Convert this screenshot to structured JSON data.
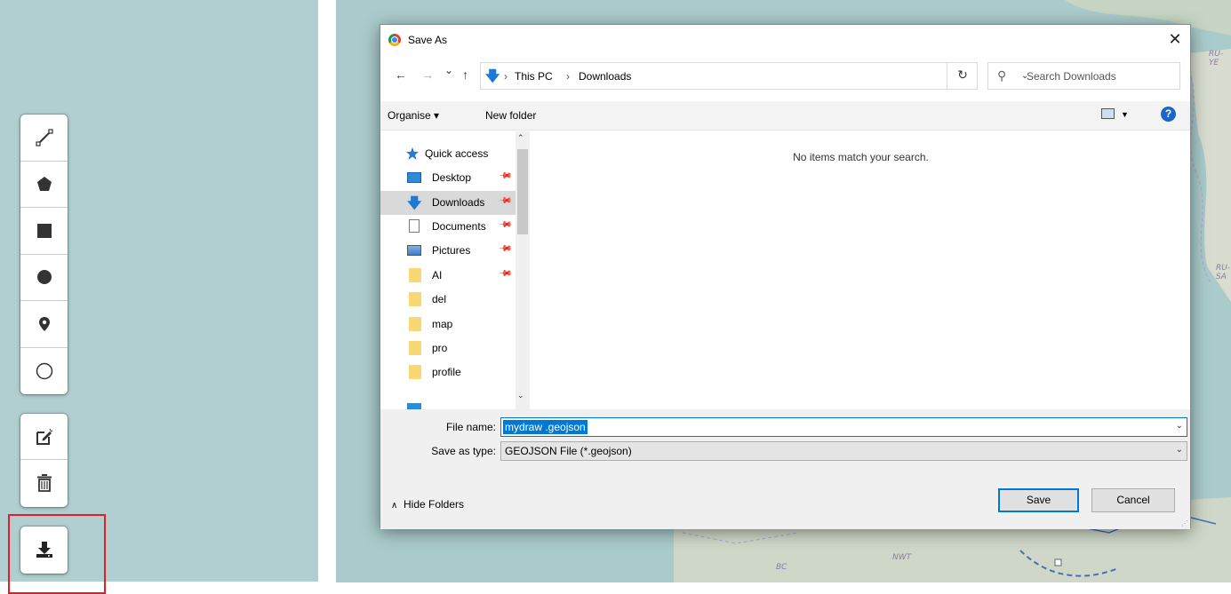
{
  "toolbar": {
    "draw_tools": [
      {
        "name": "polyline-tool",
        "icon": "polyline-icon"
      },
      {
        "name": "polygon-tool",
        "icon": "pentagon-icon"
      },
      {
        "name": "rectangle-tool",
        "icon": "square-icon"
      },
      {
        "name": "circle-tool",
        "icon": "filled-circle-icon"
      },
      {
        "name": "marker-tool",
        "icon": "map-pin-icon"
      },
      {
        "name": "circle-marker-tool",
        "icon": "hollow-circle-icon"
      }
    ],
    "edit_tools": [
      {
        "name": "edit-layers",
        "icon": "edit-icon"
      },
      {
        "name": "delete-layers",
        "icon": "trash-icon"
      }
    ],
    "export_tool": {
      "name": "export",
      "icon": "download-icon"
    },
    "highlight_color": "#e01f26"
  },
  "map": {
    "labels": [
      "RU-YE",
      "RU-SA",
      "BC",
      "NWT"
    ]
  },
  "dialog": {
    "title": "Save As",
    "close": "✕",
    "nav_buttons": [
      "←",
      "→",
      "⌄",
      "↑"
    ],
    "breadcrumb": [
      "This PC",
      "Downloads"
    ],
    "breadcrumb_sep": "›",
    "search_placeholder": "Search Downloads",
    "command_bar": {
      "organise": "Organise ▾",
      "new_folder": "New folder",
      "help": "?"
    },
    "nav_pane": {
      "items": [
        {
          "label": "Quick access",
          "icon": "star-icon",
          "pinned": false,
          "selected": false
        },
        {
          "label": "Desktop",
          "icon": "desktop-icon",
          "pinned": true,
          "selected": false
        },
        {
          "label": "Downloads",
          "icon": "downloads-icon",
          "pinned": true,
          "selected": true
        },
        {
          "label": "Documents",
          "icon": "documents-icon",
          "pinned": true,
          "selected": false
        },
        {
          "label": "Pictures",
          "icon": "pictures-icon",
          "pinned": true,
          "selected": false
        },
        {
          "label": "AI",
          "icon": "folder-icon",
          "pinned": true,
          "selected": false
        },
        {
          "label": "del",
          "icon": "folder-icon",
          "pinned": false,
          "selected": false
        },
        {
          "label": "map",
          "icon": "folder-icon",
          "pinned": false,
          "selected": false
        },
        {
          "label": "pro",
          "icon": "folder-icon",
          "pinned": false,
          "selected": false
        },
        {
          "label": "profile",
          "icon": "folder-icon",
          "pinned": false,
          "selected": false
        }
      ]
    },
    "content": {
      "empty_message": "No items match your search."
    },
    "file_name_label": "File name:",
    "file_name_value": "mydraw .geojson",
    "save_as_type_label": "Save as type:",
    "save_as_type_value": "GEOJSON File (*.geojson)",
    "hide_folders": "Hide Folders",
    "save_button": "Save",
    "cancel_button": "Cancel",
    "accent_color": "#0078d7"
  }
}
